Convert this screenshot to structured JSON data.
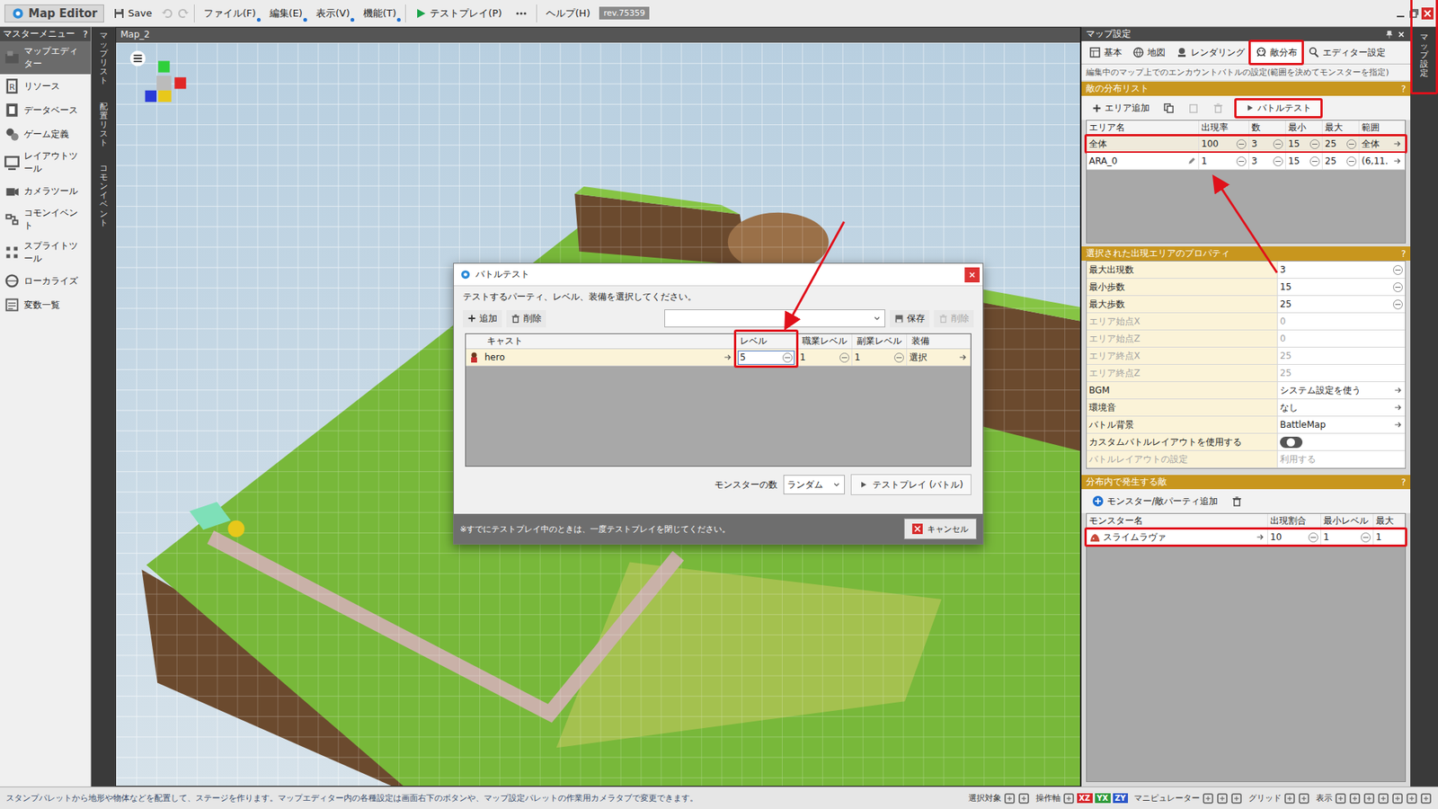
{
  "window": {
    "title": "Map Editor",
    "save": "Save",
    "menus": [
      {
        "label": "ファイル(F)"
      },
      {
        "label": "編集(E)"
      },
      {
        "label": "表示(V)"
      },
      {
        "label": "機能(T)"
      }
    ],
    "testplay": "テストプレイ(P)",
    "help": "ヘルプ(H)",
    "revision": "rev.75359"
  },
  "sidebar": {
    "title": "マスターメニュー",
    "help": "?",
    "items": [
      {
        "label": "マップエディター",
        "selected": true
      },
      {
        "label": "リソース",
        "selected": false
      },
      {
        "label": "データベース",
        "selected": false
      },
      {
        "label": "ゲーム定義",
        "selected": false
      },
      {
        "label": "レイアウトツール",
        "selected": false
      },
      {
        "label": "カメラツール",
        "selected": false
      },
      {
        "label": "コモンイベント",
        "selected": false
      },
      {
        "label": "スプライトツール",
        "selected": false
      },
      {
        "label": "ローカライズ",
        "selected": false
      },
      {
        "label": "変数一覧",
        "selected": false
      }
    ]
  },
  "side_tabs": [
    "マップリスト",
    "配置リスト",
    "コモンイベント"
  ],
  "viewport": {
    "tab": "Map_2"
  },
  "panel": {
    "title": "マップ設定",
    "tabs": [
      {
        "label": "基本",
        "selected": false,
        "highlight": false
      },
      {
        "label": "地図",
        "selected": false,
        "highlight": false
      },
      {
        "label": "レンダリング",
        "selected": false,
        "highlight": false
      },
      {
        "label": "敵分布",
        "selected": true,
        "highlight": true
      },
      {
        "label": "エディター設定",
        "selected": false,
        "highlight": false
      }
    ],
    "description": "編集中のマップ上でのエンカウントバトルの設定(範囲を決めてモンスターを指定)",
    "area": {
      "title": "敵の分布リスト",
      "help": "?",
      "add": "エリア追加",
      "battle_test": {
        "label": "バトルテスト",
        "highlight": true
      },
      "columns": [
        "エリア名",
        "出現率",
        "数",
        "最小",
        "最大",
        "範囲"
      ],
      "rows": [
        {
          "cells": [
            "全体",
            "100",
            "3",
            "15",
            "25",
            "全体"
          ],
          "selected": true,
          "highlight": true
        },
        {
          "cells": [
            "ARA_0",
            "1",
            "3",
            "15",
            "25",
            "(6,11."
          ],
          "selected": false,
          "highlight": false
        }
      ]
    },
    "props": {
      "title": "選択された出現エリアのプロパティ",
      "help": "?",
      "rows": [
        {
          "label": "最大出現数",
          "value": "3",
          "kind": "number",
          "disabled": false
        },
        {
          "label": "最小歩数",
          "value": "15",
          "kind": "number",
          "disabled": false
        },
        {
          "label": "最大歩数",
          "value": "25",
          "kind": "number",
          "disabled": false
        },
        {
          "label": "エリア始点X",
          "value": "0",
          "kind": "number",
          "disabled": true
        },
        {
          "label": "エリア始点Z",
          "value": "0",
          "kind": "number",
          "disabled": true
        },
        {
          "label": "エリア終点X",
          "value": "25",
          "kind": "number",
          "disabled": true
        },
        {
          "label": "エリア終点Z",
          "value": "25",
          "kind": "number",
          "disabled": true
        },
        {
          "label": "BGM",
          "value": "システム設定を使う",
          "kind": "link",
          "disabled": false
        },
        {
          "label": "環境音",
          "value": "なし",
          "kind": "link",
          "disabled": false
        },
        {
          "label": "バトル背景",
          "value": "BattleMap",
          "kind": "link",
          "disabled": false
        },
        {
          "label": "カスタムバトルレイアウトを使用する",
          "kind": "toggle",
          "on": false,
          "disabled": false
        },
        {
          "label": "バトルレイアウトの設定",
          "value": "利用する",
          "kind": "link",
          "disabled": true
        }
      ]
    },
    "enemies": {
      "title": "分布内で発生する敵",
      "help": "?",
      "add": "モンスター/敵パーティ追加",
      "columns": [
        "モンスター名",
        "出現割合",
        "最小レベル",
        "最大"
      ],
      "rows": [
        {
          "cells": [
            "スライムラヴァ",
            "10",
            "1",
            "1"
          ],
          "highlight": true
        }
      ]
    }
  },
  "right_strip": {
    "label": "マップ設定",
    "highlight": true
  },
  "dialog": {
    "title": "バトルテスト",
    "instruction": "テストするパーティ、レベル、装備を選択してください。",
    "add": "追加",
    "delete": "削除",
    "save": "保存",
    "delete2": "削除",
    "delete2_disabled": true,
    "columns": [
      "キャスト",
      "レベル",
      "職業レベル",
      "副業レベル",
      "装備"
    ],
    "rows": [
      {
        "cells": [
          "hero",
          "5",
          "1",
          "1",
          "選択"
        ],
        "selected": true,
        "editing_col": 1,
        "highlight_col": 1
      }
    ],
    "monster_count_label": "モンスターの数",
    "monster_count": "ランダム",
    "testplay": "テストプレイ (バトル)",
    "note": "※すでにテストプレイ中のときは、一度テストプレイを閉じてください。",
    "cancel": "キャンセル"
  },
  "status_bar": {
    "text": "スタンプパレットから地形や物体などを配置して、ステージを作ります。マップエディター内の各種設定は画面右下のボタンや、マップ設定パレットの作業用カメラタブで変更できます。",
    "tools": [
      "選択対象",
      "操作軸",
      "マニピュレーター",
      "グリッド",
      "表示"
    ],
    "axes": [
      {
        "label": "XZ",
        "color": "#d6262a"
      },
      {
        "label": "YX",
        "color": "#2e9a3a"
      },
      {
        "label": "ZY",
        "color": "#2a56c8"
      }
    ]
  }
}
